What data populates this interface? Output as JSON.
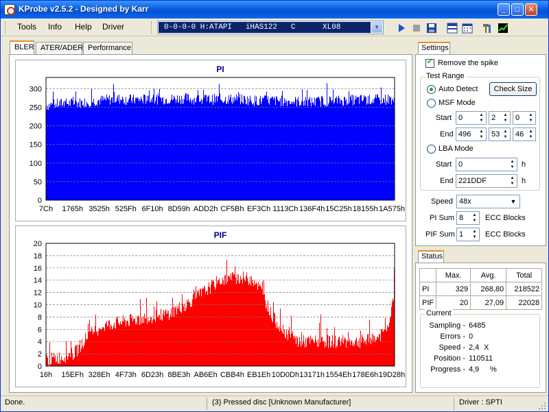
{
  "window": {
    "title": "KProbe v2.5.2 - Designed by Karr",
    "controls": {
      "minimize": "_",
      "maximize": "□",
      "close": "✕"
    }
  },
  "menu": {
    "tools": "Tools",
    "info": "Info",
    "help": "Help",
    "driver": "Driver"
  },
  "drive_select": {
    "value": "0-0-0-0 H:ATAPI   iHAS122   C      XL08"
  },
  "tabs": [
    "BLER",
    "ATER/ADER",
    "Performance"
  ],
  "settings": {
    "tab_label": "Settings",
    "remove_spike": "Remove the spike",
    "test_range_title": "Test Range",
    "auto_detect": "Auto Detect",
    "check_size": "Check Size",
    "msf_mode": "MSF Mode",
    "start_label": "Start",
    "end_label": "End",
    "msf_start": [
      "0",
      "2",
      "0"
    ],
    "msf_end": [
      "496",
      "53",
      "46"
    ],
    "lba_mode": "LBA Mode",
    "lba_start": "0",
    "lba_end": "221DDF",
    "hex_unit": "h",
    "speed_label": "Speed",
    "speed_value": "48x",
    "pi_sum_label": "PI Sum",
    "pi_sum_value": "8",
    "pif_sum_label": "PIF Sum",
    "pif_sum_value": "1",
    "ecc_blocks": "ECC Blocks"
  },
  "status": {
    "tab_label": "Status",
    "headers": [
      "Max.",
      "Avg.",
      "Total"
    ],
    "rows": [
      {
        "name": "PI",
        "max": "329",
        "avg": "268,80",
        "total": "218522"
      },
      {
        "name": "PIF",
        "max": "20",
        "avg": "27,09",
        "total": "22028"
      }
    ],
    "current_title": "Current",
    "current": [
      {
        "label": "Sampling -",
        "value": "6485",
        "unit": ""
      },
      {
        "label": "Errors -",
        "value": "0",
        "unit": ""
      },
      {
        "label": "Speed -",
        "value": "2,4",
        "unit": "X"
      },
      {
        "label": "Position -",
        "value": "110511",
        "unit": ""
      },
      {
        "label": "Progress -",
        "value": "4,9",
        "unit": "%"
      }
    ]
  },
  "statusbar": {
    "left": "Done.",
    "middle": "(3) Pressed disc [Unknown Manufacturer]",
    "right": "Driver : SPTI"
  },
  "colors": {
    "pi": "#0000ff",
    "pif": "#ff0000",
    "title_text": "#000080"
  },
  "chart_data": [
    {
      "type": "bar",
      "title": "PI",
      "ylim": [
        0,
        330
      ],
      "yticks": [
        0,
        50,
        100,
        150,
        200,
        250,
        300
      ],
      "xticks": [
        "7Ch",
        "1765h",
        "3525h",
        "525Fh",
        "6F10h",
        "8D59h",
        "ADD2h",
        "CF5Bh",
        "EF3Ch",
        "1113Ch",
        "136F4h",
        "15C25h",
        "18155h",
        "1A575h"
      ],
      "grid": true,
      "profile": [
        [
          0,
          255
        ],
        [
          0.05,
          260
        ],
        [
          0.1,
          262
        ],
        [
          0.15,
          268
        ],
        [
          0.2,
          272
        ],
        [
          0.25,
          270
        ],
        [
          0.3,
          272
        ],
        [
          0.35,
          272
        ],
        [
          0.4,
          274
        ],
        [
          0.45,
          270
        ],
        [
          0.5,
          272
        ],
        [
          0.55,
          272
        ],
        [
          0.6,
          268
        ],
        [
          0.65,
          268
        ],
        [
          0.7,
          266
        ],
        [
          0.75,
          264
        ],
        [
          0.8,
          266
        ],
        [
          0.85,
          268
        ],
        [
          0.9,
          270
        ],
        [
          0.95,
          270
        ],
        [
          1.0,
          272
        ]
      ],
      "max": 329
    },
    {
      "type": "bar",
      "title": "PIF",
      "ylim": [
        0,
        20
      ],
      "yticks": [
        0,
        2,
        4,
        6,
        8,
        10,
        12,
        14,
        16,
        18,
        20
      ],
      "xticks": [
        "16h",
        "15EFh",
        "328Eh",
        "4F73h",
        "6D23h",
        "8BE3h",
        "AB6Eh",
        "CBB4h",
        "EB1Eh",
        "10D0Dh",
        "13171h",
        "1554Eh",
        "178E6h",
        "19D28h"
      ],
      "grid": true,
      "profile": [
        [
          0,
          1
        ],
        [
          0.05,
          1.5
        ],
        [
          0.08,
          2
        ],
        [
          0.12,
          5
        ],
        [
          0.16,
          6.5
        ],
        [
          0.2,
          7
        ],
        [
          0.25,
          7.5
        ],
        [
          0.3,
          8
        ],
        [
          0.35,
          8.5
        ],
        [
          0.4,
          10
        ],
        [
          0.45,
          12
        ],
        [
          0.5,
          14
        ],
        [
          0.55,
          14.5
        ],
        [
          0.6,
          14
        ],
        [
          0.62,
          12
        ],
        [
          0.65,
          8
        ],
        [
          0.68,
          6
        ],
        [
          0.72,
          4
        ],
        [
          0.8,
          4
        ],
        [
          0.85,
          4
        ],
        [
          0.9,
          4
        ],
        [
          0.95,
          4.5
        ],
        [
          0.98,
          6
        ],
        [
          1.0,
          12
        ]
      ],
      "max": 20
    }
  ]
}
